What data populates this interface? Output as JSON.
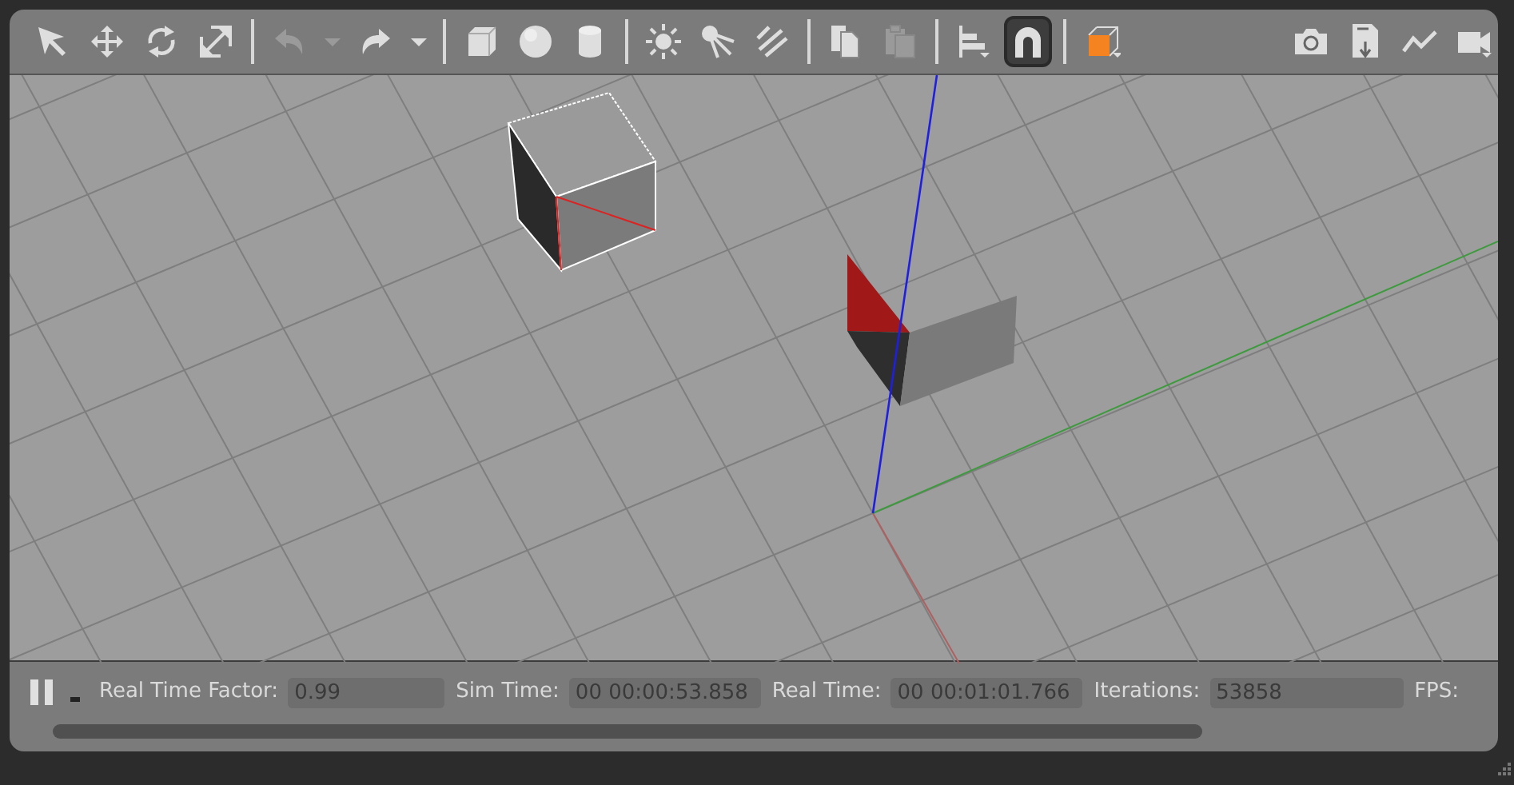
{
  "toolbar": {
    "tools": [
      {
        "kind": "select",
        "selected": false,
        "disabled": false
      },
      {
        "kind": "translate",
        "selected": false,
        "disabled": false
      },
      {
        "kind": "rotate",
        "selected": false,
        "disabled": false
      },
      {
        "kind": "scale",
        "selected": false,
        "disabled": false
      },
      {
        "kind": "separator"
      },
      {
        "kind": "undo",
        "selected": false,
        "disabled": true
      },
      {
        "kind": "dropdown",
        "selected": false,
        "disabled": true
      },
      {
        "kind": "redo",
        "selected": false,
        "disabled": false
      },
      {
        "kind": "dropdown",
        "selected": false,
        "disabled": false
      },
      {
        "kind": "separator"
      },
      {
        "kind": "box",
        "selected": false,
        "disabled": false
      },
      {
        "kind": "sphere",
        "selected": false,
        "disabled": false
      },
      {
        "kind": "cylinder",
        "selected": false,
        "disabled": false
      },
      {
        "kind": "separator"
      },
      {
        "kind": "point-light",
        "selected": false,
        "disabled": false
      },
      {
        "kind": "spot-light",
        "selected": false,
        "disabled": false
      },
      {
        "kind": "directional-light",
        "selected": false,
        "disabled": false
      },
      {
        "kind": "separator"
      },
      {
        "kind": "copy",
        "selected": false,
        "disabled": false
      },
      {
        "kind": "paste",
        "selected": false,
        "disabled": true
      },
      {
        "kind": "separator"
      },
      {
        "kind": "align",
        "selected": false,
        "disabled": false
      },
      {
        "kind": "snap",
        "selected": true,
        "disabled": false
      },
      {
        "kind": "separator"
      },
      {
        "kind": "view-angle",
        "selected": false,
        "disabled": false
      },
      {
        "kind": "spacer"
      },
      {
        "kind": "screenshot",
        "selected": false,
        "disabled": false
      },
      {
        "kind": "log",
        "selected": false,
        "disabled": false
      },
      {
        "kind": "plot",
        "selected": false,
        "disabled": false
      },
      {
        "kind": "record",
        "selected": false,
        "disabled": false
      }
    ]
  },
  "status_bar": {
    "paused": false,
    "stats": [
      {
        "label": "Real Time Factor:",
        "value": "0.99"
      },
      {
        "label": "Sim Time:",
        "value": "00 00:00:53.858"
      },
      {
        "label": "Real Time:",
        "value": "00 00:01:01.766"
      },
      {
        "label": "Iterations:",
        "value": "53858"
      },
      {
        "label": "FPS:"
      }
    ]
  }
}
